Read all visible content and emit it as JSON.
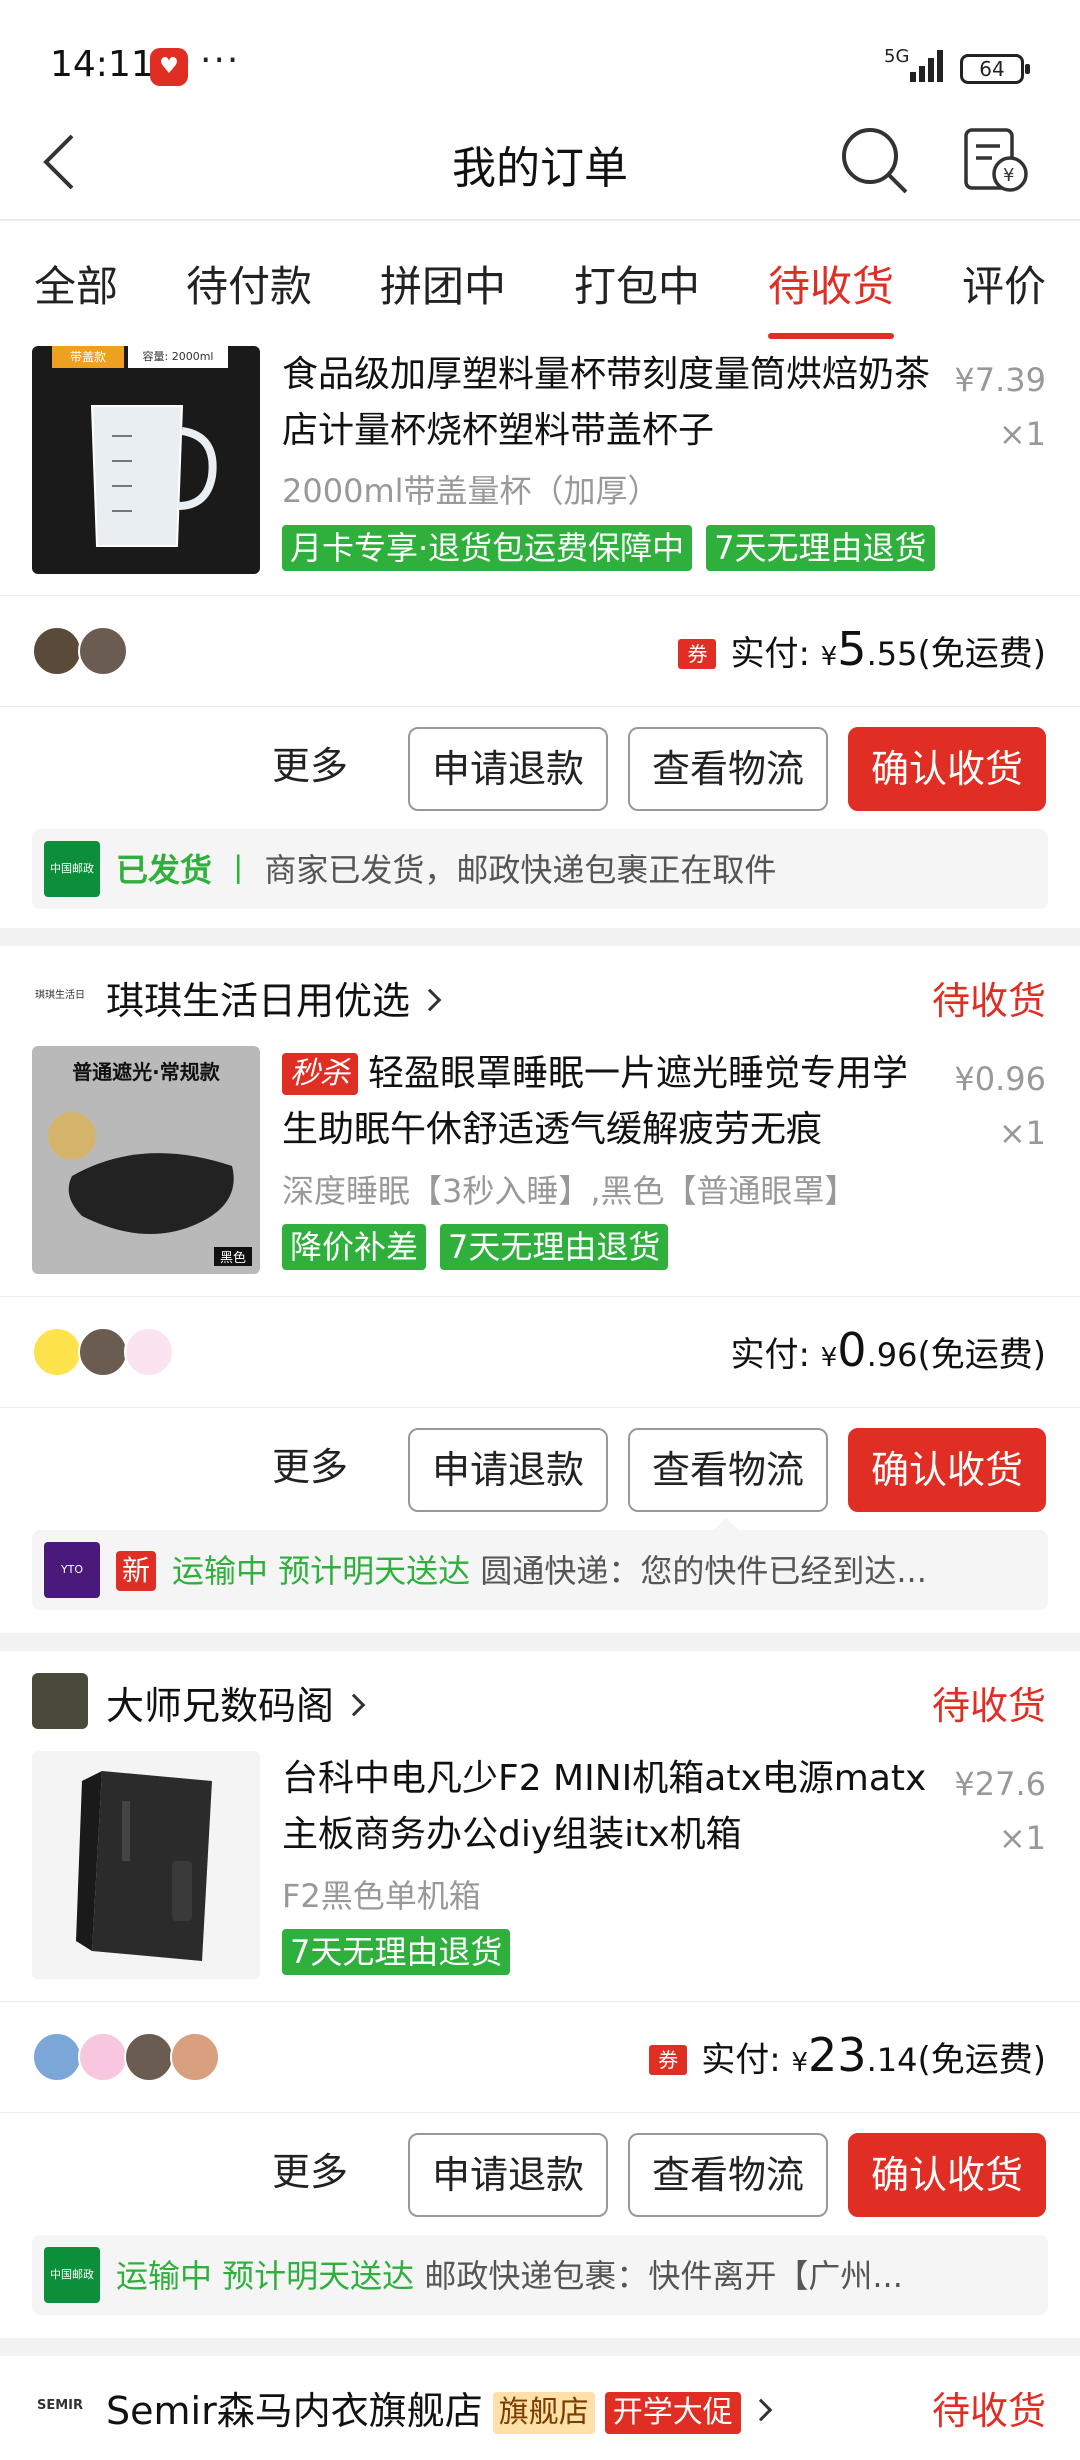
{
  "status_bar": {
    "time": "14:11",
    "app_badge": "♥",
    "dots": "···",
    "network": "5G",
    "battery": "64"
  },
  "header": {
    "title": "我的订单"
  },
  "tabs": [
    {
      "label": "全部"
    },
    {
      "label": "待付款"
    },
    {
      "label": "拼团中"
    },
    {
      "label": "打包中"
    },
    {
      "label": "待收货",
      "active": true
    },
    {
      "label": "评价"
    }
  ],
  "orders": [
    {
      "product": {
        "image_label_a": "带盖款",
        "image_label_b": "容量: 2000ml",
        "title": "食品级加厚塑料量杯带刻度量筒烘焙奶茶店计量杯烧杯塑料带盖杯子",
        "price": "¥7.39",
        "qty": "×1",
        "spec": "2000ml带盖量杯（加厚）",
        "tags": [
          "月卡专享·退货包运费保障中",
          "7天无理由退货"
        ]
      },
      "paid": {
        "label": "实付:",
        "yen": "¥",
        "int": "5",
        "dec": ".55",
        "note": "(免运费)",
        "coupon": "券"
      },
      "actions": {
        "more": "更多",
        "refund": "申请退款",
        "logistics": "查看物流",
        "confirm": "确认收货"
      },
      "track": {
        "logo": "中国邮政",
        "status": "已发货",
        "sep": "丨",
        "text": "商家已发货，邮政快递包裹正在取件"
      }
    },
    {
      "store": {
        "name": "琪琪生活日用优选",
        "status": "待收货",
        "logo": "琪琪生活日用"
      },
      "product": {
        "image_label_a": "普通遮光·常规款",
        "image_label_b": "黑色",
        "flash": "秒杀",
        "title": "轻盈眼罩睡眠一片遮光睡觉专用学生助眠午休舒适透气缓解疲劳无痕",
        "price": "¥0.96",
        "qty": "×1",
        "spec": "深度睡眠【3秒入睡】,黑色【普通眼罩】",
        "tags": [
          "降价补差",
          "7天无理由退货"
        ]
      },
      "paid": {
        "label": "实付:",
        "yen": "¥",
        "int": "0",
        "dec": ".96",
        "note": "(免运费)"
      },
      "actions": {
        "more": "更多",
        "refund": "申请退款",
        "logistics": "查看物流",
        "confirm": "确认收货"
      },
      "track": {
        "logo": "YTO",
        "new": "新",
        "status": "运输中 预计明天送达",
        "text": "圆通快递：您的快件已经到达..."
      }
    },
    {
      "store": {
        "name": "大师兄数码阁",
        "status": "待收货"
      },
      "product": {
        "title": "台科中电凡少F2 MINI机箱atx电源matx主板商务办公diy组装itx机箱",
        "price": "¥27.6",
        "qty": "×1",
        "spec": "F2黑色单机箱",
        "tags": [
          "7天无理由退货"
        ]
      },
      "paid": {
        "label": "实付:",
        "yen": "¥",
        "int": "23",
        "dec": ".14",
        "note": "(免运费)",
        "coupon": "券"
      },
      "actions": {
        "more": "更多",
        "refund": "申请退款",
        "logistics": "查看物流",
        "confirm": "确认收货"
      },
      "track": {
        "logo": "中国邮政",
        "status": "运输中 预计明天送达",
        "text": "邮政快递包裹：快件离开【广州..."
      }
    },
    {
      "store": {
        "name": "Semir森马内衣旗舰店",
        "flag": "旗舰店",
        "promo": "开学大促",
        "status": "待收货",
        "logo": "SEMIR"
      }
    }
  ],
  "colors": {
    "accent": "#e02e24",
    "green": "#2fb03d",
    "muted": "#999999"
  }
}
